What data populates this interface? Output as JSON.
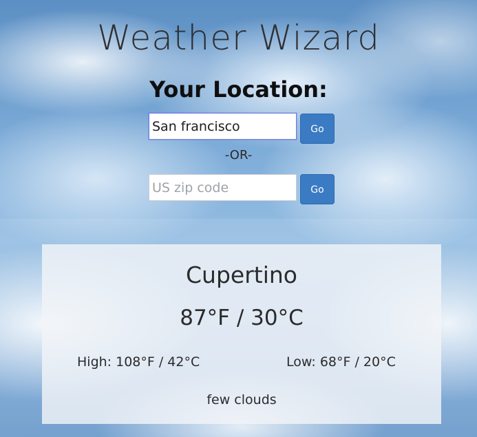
{
  "app": {
    "title": "Weather Wizard"
  },
  "search": {
    "heading": "Your Location:",
    "city_value": "San francisco",
    "city_placeholder": "",
    "go_label": "Go",
    "or_label": "-OR-",
    "zip_value": "",
    "zip_placeholder": "US zip code"
  },
  "weather": {
    "city": "Cupertino",
    "temperature": "87°F / 30°C",
    "high": "High: 108°F / 42°C",
    "low": "Low: 68°F / 20°C",
    "description": "few clouds"
  },
  "colors": {
    "button": "#3a7bc3",
    "card_background": "#f1f4f8",
    "sky": "#6fa2d3"
  }
}
